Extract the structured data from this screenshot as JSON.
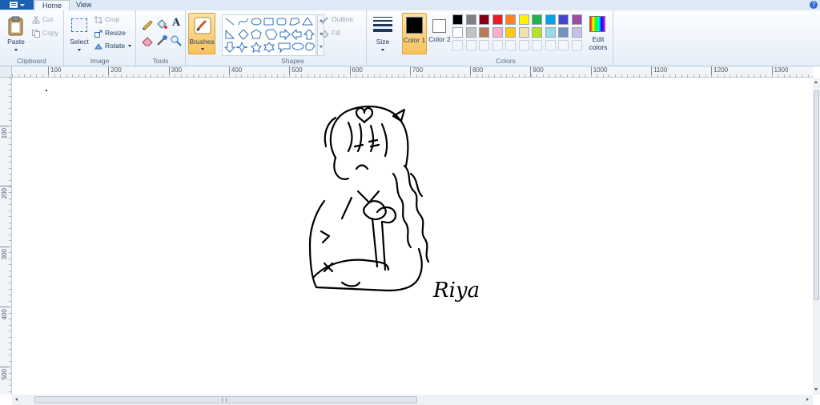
{
  "tabs": {
    "home": "Home",
    "view": "View"
  },
  "help_icon": "?",
  "clipboard": {
    "paste": "Paste",
    "cut": "Cut",
    "copy": "Copy",
    "label": "Clipboard"
  },
  "image": {
    "select": "Select",
    "crop": "Crop",
    "resize": "Resize",
    "rotate": "Rotate",
    "label": "Image"
  },
  "tools": {
    "label": "Tools"
  },
  "brushes": {
    "label": "Brushes"
  },
  "shapes": {
    "label": "Shapes",
    "outline": "Outline",
    "fill": "Fill"
  },
  "size": {
    "label": "Size"
  },
  "colors": {
    "color1_label": "Color 1",
    "color2_label": "Color 2",
    "edit_label": "Edit colors",
    "group_label": "Colors",
    "color1": "#000000",
    "color2": "#ffffff",
    "palette_row1": [
      "#000000",
      "#7f7f7f",
      "#880015",
      "#ed1c24",
      "#ff7f27",
      "#fff200",
      "#22b14c",
      "#00a2e8",
      "#3f48cc",
      "#a349a4"
    ],
    "palette_row2": [
      "#ffffff",
      "#c3c3c3",
      "#b97a57",
      "#ffaec9",
      "#ffc90e",
      "#efe4b0",
      "#b5e61d",
      "#99d9ea",
      "#7092be",
      "#c8bfe7"
    ]
  },
  "ruler": {
    "top_labels": [
      "100",
      "200",
      "300",
      "400",
      "500",
      "600",
      "700",
      "800",
      "900",
      "1000",
      "1100",
      "1200",
      "1300"
    ],
    "left_labels": [
      "100",
      "200",
      "300",
      "400",
      "500"
    ]
  },
  "canvas": {
    "signature": "Riya"
  }
}
